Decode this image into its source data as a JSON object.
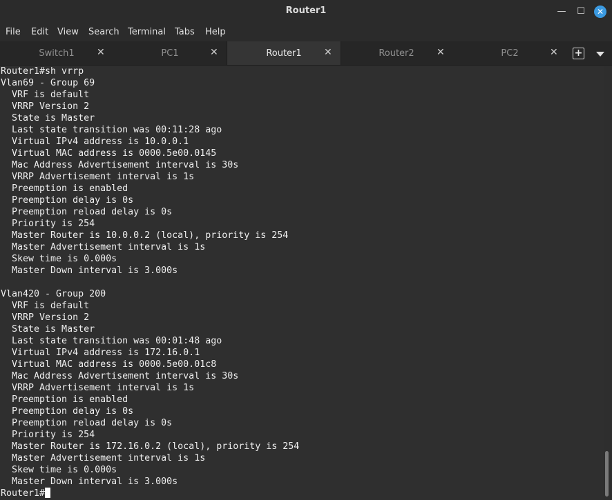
{
  "window": {
    "title": "Router1"
  },
  "menu": [
    "File",
    "Edit",
    "View",
    "Search",
    "Terminal",
    "Tabs",
    "Help"
  ],
  "tabs": [
    {
      "label": "Switch1",
      "active": false
    },
    {
      "label": "PC1",
      "active": false
    },
    {
      "label": "Router1",
      "active": true
    },
    {
      "label": "Router2",
      "active": false
    },
    {
      "label": "PC2",
      "active": false
    }
  ],
  "terminal": {
    "prompt": "Router1#",
    "lines": [
      "Router1#sh vrrp",
      "Vlan69 - Group 69",
      "  VRF is default",
      "  VRRP Version 2",
      "  State is Master",
      "  Last state transition was 00:11:28 ago",
      "  Virtual IPv4 address is 10.0.0.1",
      "  Virtual MAC address is 0000.5e00.0145",
      "  Mac Address Advertisement interval is 30s",
      "  VRRP Advertisement interval is 1s",
      "  Preemption is enabled",
      "  Preemption delay is 0s",
      "  Preemption reload delay is 0s",
      "  Priority is 254",
      "  Master Router is 10.0.0.2 (local), priority is 254",
      "  Master Advertisement interval is 1s",
      "  Skew time is 0.000s",
      "  Master Down interval is 3.000s",
      "",
      "Vlan420 - Group 200",
      "  VRF is default",
      "  VRRP Version 2",
      "  State is Master",
      "  Last state transition was 00:01:48 ago",
      "  Virtual IPv4 address is 172.16.0.1",
      "  Virtual MAC address is 0000.5e00.01c8",
      "  Mac Address Advertisement interval is 30s",
      "  VRRP Advertisement interval is 1s",
      "  Preemption is enabled",
      "  Preemption delay is 0s",
      "  Preemption reload delay is 0s",
      "  Priority is 254",
      "  Master Router is 172.16.0.2 (local), priority is 254",
      "  Master Advertisement interval is 1s",
      "  Skew time is 0.000s",
      "  Master Down interval is 3.000s"
    ]
  }
}
